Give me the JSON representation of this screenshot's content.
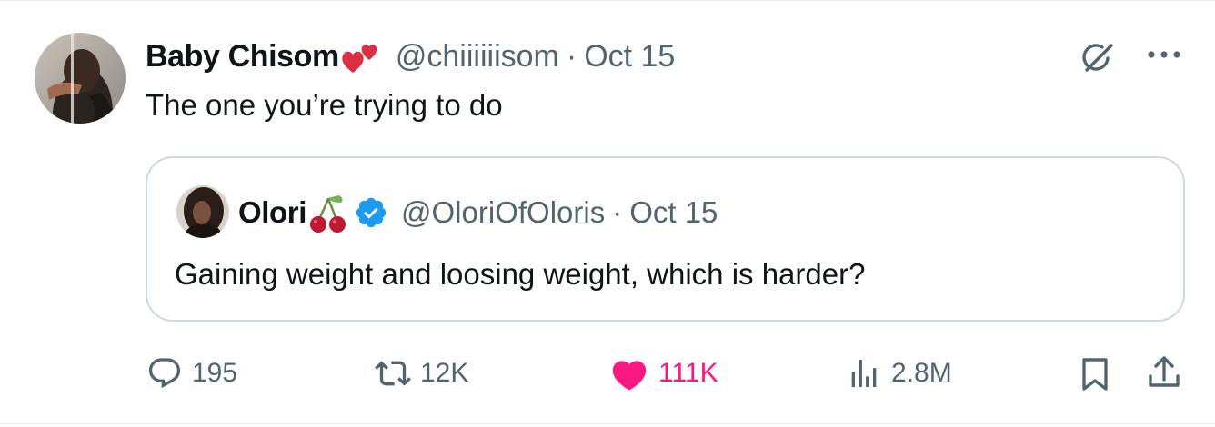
{
  "author": {
    "display_name": "Baby Chisom",
    "handle": "@chiiiiiisom",
    "separator": "·",
    "date": "Oct 15",
    "name_emoji": "two-hearts-icon"
  },
  "tweet": {
    "text": "The one you’re trying to do"
  },
  "quoted": {
    "display_name": "Olori",
    "handle": "@OloriOfOloris",
    "separator": "·",
    "date": "Oct 15",
    "name_emoji": "cherries-icon",
    "verified": true,
    "text": "Gaining weight and loosing weight, which is harder?"
  },
  "actions": {
    "replies": "195",
    "retweets": "12K",
    "likes": "111K",
    "views": "2.8M"
  },
  "colors": {
    "text": "#0f1419",
    "secondary": "#536471",
    "like": "#f91880",
    "verified": "#1d9bf0",
    "border": "#cfd9de"
  }
}
